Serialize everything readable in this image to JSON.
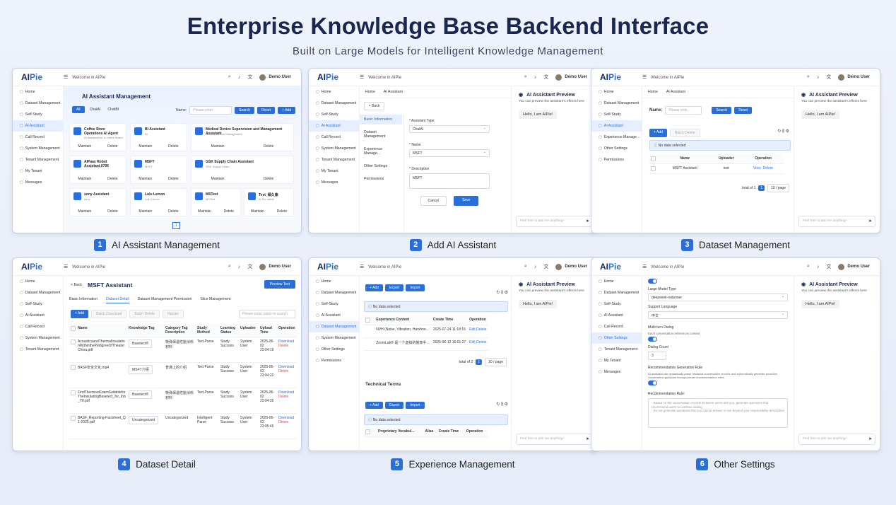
{
  "header": {
    "title": "Enterprise Knowledge Base Backend Interface",
    "subtitle": "Built on Large Models for Intelligent Knowledge Management"
  },
  "common": {
    "logo_a": "AI",
    "logo_b": "Pie",
    "welcome": "Welcome in AIPie",
    "user": "Demo User",
    "preview_title": "AI Assistant Preview",
    "preview_sub": "You can preview the assistant's effects here",
    "preview_hello": "Hello, I am AIPie!",
    "ask_placeholder": "Feel free to ask me anything~"
  },
  "captions": [
    {
      "num": "1",
      "label": "AI Assistant Management"
    },
    {
      "num": "2",
      "label": "Add AI Assistant"
    },
    {
      "num": "3",
      "label": "Dataset Management"
    },
    {
      "num": "4",
      "label": "Dataset Detail"
    },
    {
      "num": "5",
      "label": "Experience Management"
    },
    {
      "num": "6",
      "label": "Other Settings"
    }
  ],
  "p1": {
    "nav": [
      "Home",
      "Dataset Management",
      "Self-Study",
      "AI Assistant",
      "Call Record",
      "System Management",
      "Tenant Management",
      "My Tenant",
      "Messages"
    ],
    "title": "AI Assistant Management",
    "tabs": [
      "All",
      "ChatAI",
      "ChatBI"
    ],
    "name_label": "Name:",
    "name_ph": "Please enter",
    "search": "Search",
    "reset": "Reset",
    "add": "+ Add",
    "cards": [
      {
        "title": "Coffee Store Operations AI Agent",
        "sub": "AI Assistant for a Coffee Brand"
      },
      {
        "title": "BI Assistant",
        "sub": "BI"
      },
      {
        "title": "Medical Device Supervision and Management Assistant",
        "sub": "Medical Device Management"
      },
      {
        "title": "AIPaas Robot Assistant 0706",
        "sub": "AIPaas Robot"
      },
      {
        "title": "MSFT",
        "sub": "MSFT"
      },
      {
        "title": "GSK Supply Chain Assistant",
        "sub": "GSK Supply Chain"
      },
      {
        "title": "sony Assistant",
        "sub": "sony"
      },
      {
        "title": "Lulu Lemon",
        "sub": "Lulu Lemon"
      },
      {
        "title": "MSTest",
        "sub": "MSTest"
      },
      {
        "title": "Test_细久像",
        "sub": "AI Six rabbit"
      }
    ],
    "maintain": "Maintain",
    "delete": "Delete",
    "page": "1"
  },
  "p2": {
    "nav": [
      "Home",
      "Dataset Management",
      "Self-Study",
      "AI Assistant",
      "Call Record",
      "System Management",
      "Tenant Management",
      "My Tenant",
      "Messages"
    ],
    "crumb_home": "Home",
    "crumb_cur": "AI Assistant",
    "back": "< Back",
    "subnav": [
      "Basic Information",
      "Dataset Management",
      "Experience Manage...",
      "Other Settings",
      "Permissions"
    ],
    "type_label": "* Assistant Type",
    "type_val": "ChatAI",
    "name_label": "* Name",
    "name_val": "MSFT",
    "desc_label": "* Description",
    "desc_val": "MSFT",
    "cancel": "Cancel",
    "save": "Save"
  },
  "p3": {
    "nav": [
      "Home",
      "Dataset Management",
      "Self-Study",
      "AI Assistant",
      "Experience Manage...",
      "Other Settings",
      "Permissions"
    ],
    "crumb_home": "Home",
    "crumb_cur": "AI Assistant",
    "name_label": "Name:",
    "name_ph": "Please ente...",
    "search": "Search",
    "reset": "Reset",
    "add": "+ Add",
    "batch": "Batch Delete",
    "nodata": "No data selected",
    "cols": [
      "Name",
      "Uploader",
      "Operation"
    ],
    "row": {
      "name": "MSFT Assistant",
      "uploader": "test",
      "view": "View",
      "del": "Delete"
    },
    "total": "total of 1",
    "page": "1",
    "per": "10 / page"
  },
  "p4": {
    "nav": [
      "Home",
      "Dataset Management",
      "Self-Study",
      "AI Assistant",
      "Call Record",
      "System Management",
      "Tenant Management"
    ],
    "back": "< Back",
    "title": "MSFT Assistant",
    "preview": "Preview Test",
    "tabs": [
      "Basic Information",
      "Dataset Detail",
      "Dataset Management Permission",
      "Slice Management"
    ],
    "add": "+ Add",
    "batch_dl": "Batch Download",
    "batch_del": "Batch Delete",
    "retrain": "Retrain",
    "search_ph": "Please enter name to search",
    "cols": [
      "Name",
      "Knowledge Tag",
      "Category Tag Description",
      "Study Method",
      "Learning Status",
      "Uploader",
      "Upload Time",
      "Operation"
    ],
    "rows": [
      {
        "name": "AcousticsandThermalInsulationWithinthePedigreeOfTheaterChina.pdf",
        "tag": "Basetect®",
        "cat": "特殊保温性能涂料材料",
        "method": "Text Parse",
        "status": "Study Success",
        "up": "System User",
        "time": "2025-06-02 23:04:19"
      },
      {
        "name": "BASF安全文化.mp4",
        "tag": "MSFT介绍",
        "cat": "普通上的介绍",
        "method": "Text Parse",
        "status": "Study Success",
        "up": "System User",
        "time": "2025-06-02 23:04:20"
      },
      {
        "name": "FindThermostFoamSuitableforTheInsulatingBasetect_for_Inb_T0.pdf",
        "tag": "Basetect®",
        "cat": "特殊保温性能涂料材料",
        "method": "Text Parse",
        "status": "Study Success",
        "up": "System User",
        "time": "2025-06-02 23:04:35"
      },
      {
        "name": "BASF_Reporting-Factsheet_Q1-2025.pdf",
        "tag": "Uncategorized",
        "cat": "Uncategorized",
        "method": "Intelligent Parse",
        "status": "Study Success",
        "up": "System User",
        "time": "2025-06-02 23:05:45"
      }
    ],
    "download": "Download",
    "delete": "Delete"
  },
  "p5": {
    "nav": [
      "Home",
      "Dataset Management",
      "Self-Study",
      "AI Assistant",
      "Dataset Management",
      "System Management",
      "Other Settings",
      "Permissions"
    ],
    "add": "+ Add",
    "export": "Export",
    "import": "Import",
    "nodata": "No data selected",
    "cols": [
      "Experience Content",
      "Create Time",
      "Operation"
    ],
    "rows": [
      {
        "c": "NVH (Noise, Vibration, Harshne...",
        "t": "2025-07-24 11:18:15"
      },
      {
        "c": "ZoomLab® 是一个虚拟的装饰手...",
        "t": "2025-06-12 16:01:27"
      }
    ],
    "edit": "Edit",
    "del": "Delete",
    "total": "total of 2",
    "page": "1",
    "per": "10 / page",
    "tech_title": "Technical Terms",
    "tech_cols": [
      "Proprietary Vocabul...",
      "Alias",
      "Create Time",
      "Operation"
    ]
  },
  "p6": {
    "nav": [
      "Home",
      "Dataset Management",
      "Self-Study",
      "AI Assistant",
      "Call Record",
      "Other Settings",
      "Tenant Management",
      "My Tenant",
      "Messages"
    ],
    "model_label": "Large Model Type",
    "model_val": "deepseek-reasoner",
    "lang_label": "Support Language",
    "lang_val": "中文",
    "multi_label": "Multi-turn Dialog",
    "multi_desc": "Each conversation references context",
    "count_label": "Dialog Count",
    "count_val": "3",
    "rec_label": "Recommendation Generation Rule",
    "rec_desc": "AI assistant can dynamically parse historical conversation records and automatically generate proactive conversation guidance through preset recommendation rules",
    "rule_label": "Recommendation Rule:",
    "rule_1": "- Based on the conversation records between users and you, generate questions that recommend users to continue asking",
    "rule_2": "- Do not generate questions that you cannot answer or are beyond your responsibility description"
  }
}
